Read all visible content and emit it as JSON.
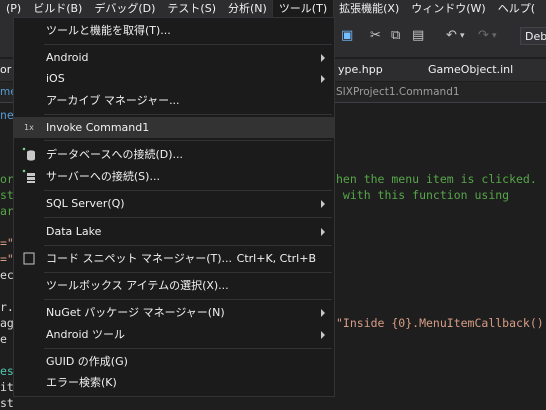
{
  "menubar": {
    "items": [
      "(P)",
      "ビルド(B)",
      "デバッグ(D)",
      "テスト(S)",
      "分析(N)",
      "ツール(T)",
      "拡張機能(X)",
      "ウィンドウ(W)",
      "ヘルプ("
    ]
  },
  "toolbar": {
    "config_value": "Deb"
  },
  "tabs": {
    "left_fragment": "or",
    "tab1": "ype.hpp",
    "tab2": "GameObject.inl"
  },
  "pathbar": {
    "left_fragment": "me",
    "scope": "SIXProject1.Command1"
  },
  "code": {
    "lines_right": [
      {
        "text": "hen the menu item is clicked.",
        "color": "#57a64a"
      },
      {
        "text": " with this function using",
        "color": "#57a64a"
      },
      {
        "text": "\"Inside {0}.MenuItemCallback()",
        "color": "#d69d85"
      }
    ],
    "lines_left": [
      {
        "text": "or",
        "color": "#57a64a"
      },
      {
        "text": "st",
        "color": "#57a64a"
      },
      {
        "text": "ar",
        "color": "#57a64a"
      },
      {
        "text": "=\"",
        "color": "#d69d85"
      },
      {
        "text": "=\"",
        "color": "#d69d85"
      },
      {
        "text": "ec",
        "color": "#dcdcdc"
      },
      {
        "text": "r.",
        "color": "#dcdcdc"
      },
      {
        "text": "ag",
        "color": "#dcdcdc"
      },
      {
        "text": "e",
        "color": "#dcdcdc"
      },
      {
        "text": "es",
        "color": "#4ec9b0"
      },
      {
        "text": "it",
        "color": "#dcdcdc"
      },
      {
        "text": "st",
        "color": "#dcdcdc"
      }
    ]
  },
  "tools_menu": {
    "items": [
      {
        "label": "ツールと機能を取得(T)...",
        "shortcut": "",
        "submenu": false,
        "icon": ""
      },
      {
        "label": "Android",
        "shortcut": "",
        "submenu": true,
        "icon": ""
      },
      {
        "label": "iOS",
        "shortcut": "",
        "submenu": true,
        "icon": ""
      },
      {
        "label": "アーカイブ マネージャー...",
        "shortcut": "",
        "submenu": false,
        "icon": ""
      },
      {
        "label": "Invoke Command1",
        "shortcut": "",
        "submenu": false,
        "icon": "1x"
      },
      {
        "label": "データベースへの接続(D)...",
        "shortcut": "",
        "submenu": false,
        "icon": "database-connect-icon"
      },
      {
        "label": "サーバーへの接続(S)...",
        "shortcut": "",
        "submenu": false,
        "icon": "server-connect-icon"
      },
      {
        "label": "SQL Server(Q)",
        "shortcut": "",
        "submenu": true,
        "icon": ""
      },
      {
        "label": "Data Lake",
        "shortcut": "",
        "submenu": true,
        "icon": ""
      },
      {
        "label": "コード スニペット マネージャー(T)...",
        "shortcut": "Ctrl+K, Ctrl+B",
        "submenu": false,
        "icon": "snippet-checkbox-icon"
      },
      {
        "label": "ツールボックス アイテムの選択(X)...",
        "shortcut": "",
        "submenu": false,
        "icon": ""
      },
      {
        "label": "NuGet パッケージ マネージャー(N)",
        "shortcut": "",
        "submenu": true,
        "icon": ""
      },
      {
        "label": "Android ツール",
        "shortcut": "",
        "submenu": true,
        "icon": ""
      },
      {
        "label": "GUID の作成(G)",
        "shortcut": "",
        "submenu": false,
        "icon": ""
      },
      {
        "label": "エラー検索(K)",
        "shortcut": "",
        "submenu": false,
        "icon": ""
      }
    ]
  }
}
